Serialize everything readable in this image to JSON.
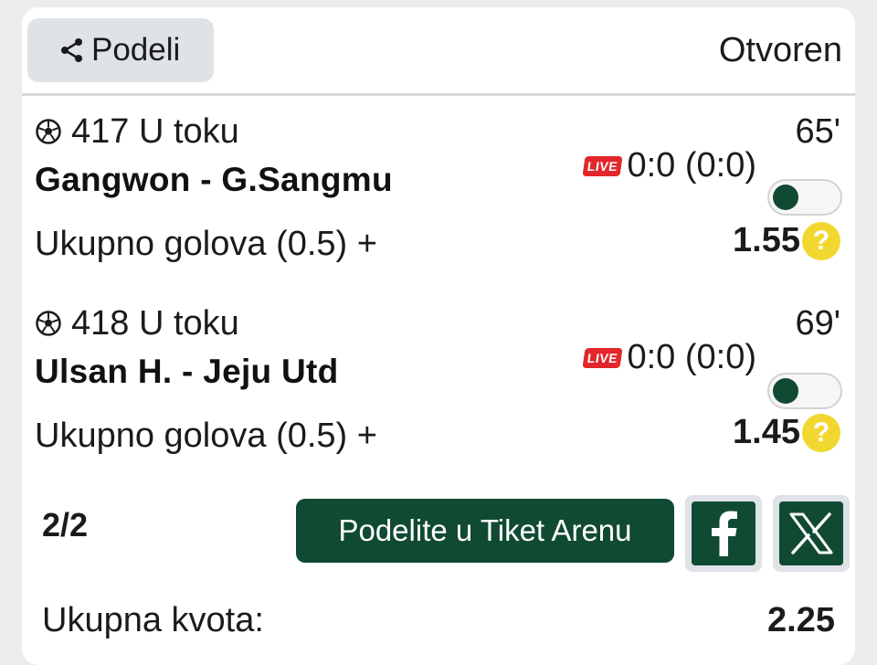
{
  "header": {
    "share_label": "Podeli",
    "status": "Otvoren"
  },
  "matches": [
    {
      "sport_icon": "soccer-ball-icon",
      "id_status": "417 U toku",
      "minute": "65'",
      "teams": "Gangwon - G.Sangmu",
      "live_label": "LIVE",
      "score": "0:0 (0:0)",
      "market": "Ukupno golova (0.5) +",
      "odd": "1.55",
      "help": "?"
    },
    {
      "sport_icon": "soccer-ball-icon",
      "id_status": "418 U toku",
      "minute": "69'",
      "teams": "Ulsan H. - Jeju Utd",
      "live_label": "LIVE",
      "score": "0:0 (0:0)",
      "market": "Ukupno golova (0.5) +",
      "odd": "1.45",
      "help": "?"
    }
  ],
  "footer": {
    "count": "2/2",
    "arena_button": "Podelite u Tiket Arenu",
    "facebook_icon": "facebook-icon",
    "x_icon": "x-twitter-icon"
  },
  "total": {
    "label": "Ukupna kvota:",
    "value": "2.25"
  },
  "colors": {
    "primary": "#114a33",
    "live": "#e3262b",
    "help": "#f2d730",
    "button_bg": "#dfe2e6"
  }
}
